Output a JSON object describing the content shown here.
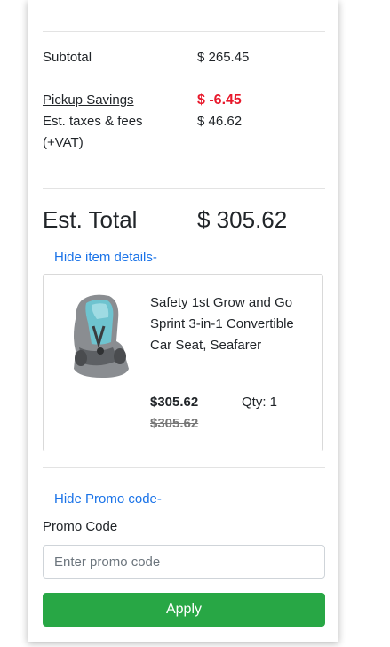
{
  "summary": {
    "subtotal_label": "Subtotal",
    "subtotal_value": "$ 265.45",
    "savings_label": "Pickup Savings",
    "savings_value": "$ -6.45",
    "taxes_label_line1": "Est. taxes & fees",
    "taxes_label_line2": "(+VAT)",
    "taxes_value": "$ 46.62",
    "total_label": "Est. Total",
    "total_value": "$ 305.62"
  },
  "item_details": {
    "toggle_label": "Hide item details-",
    "item": {
      "name": "Safety 1st Grow and Go Sprint 3-in-1 Convertible Car Seat, Seafarer",
      "price": "$305.62",
      "original_price": "$305.62",
      "quantity": "Qty: 1",
      "image_icon": "car-seat-image"
    }
  },
  "promo": {
    "toggle_label": "Hide Promo code-",
    "label": "Promo Code",
    "placeholder": "Enter promo code",
    "value": "",
    "apply_label": "Apply"
  },
  "colors": {
    "savings": "#e8192c",
    "link": "#1a73e8",
    "apply_button": "#28a745"
  }
}
